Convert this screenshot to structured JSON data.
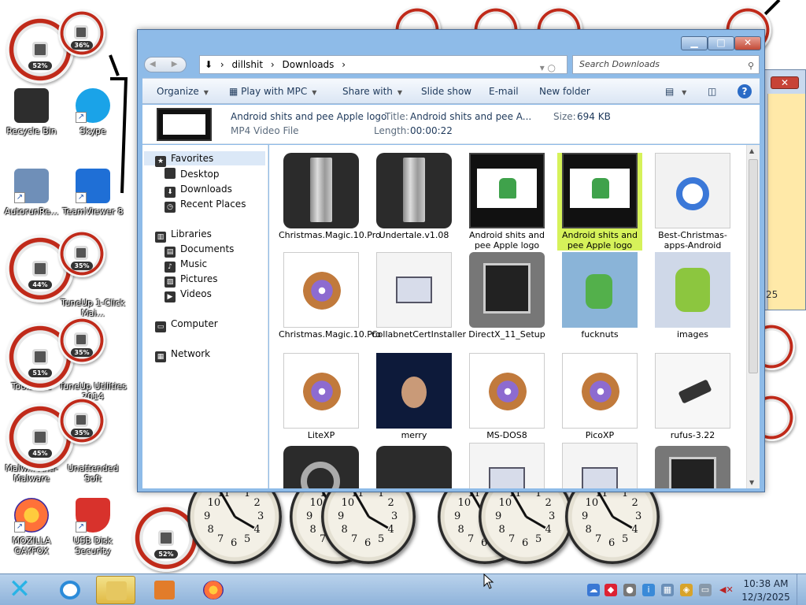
{
  "desktop": {
    "icons": [
      {
        "label": "Recycle Bin"
      },
      {
        "label": "Skype"
      },
      {
        "label": "AutorunRe..."
      },
      {
        "label": "TeamViewer 8"
      },
      {
        "label": "TuneUp 1-Click Mai..."
      },
      {
        "label": "TuneUp Utilities 2014"
      },
      {
        "label": "Tools Lite"
      },
      {
        "label": "Unattended Soft"
      },
      {
        "label": "Malw... Anti-Malware"
      },
      {
        "label": "MOZILLA GAYFOX"
      },
      {
        "label": "USB Disk Security"
      }
    ],
    "gauges": [
      "52%",
      "36%",
      "44%",
      "35%",
      "51%",
      "35%",
      "45%",
      "35%",
      "52%"
    ],
    "clock_numerals": [
      "12",
      "1",
      "2",
      "3",
      "4",
      "5",
      "6",
      "7",
      "8",
      "9",
      "10",
      "11"
    ],
    "bg_window_number": "25"
  },
  "explorer": {
    "address": {
      "segments": [
        "dillshit",
        "Downloads"
      ],
      "search_placeholder": "Search Downloads"
    },
    "toolbar": {
      "organize": "Organize",
      "play": "Play with MPC",
      "share": "Share with",
      "slideshow": "Slide show",
      "email": "E-mail",
      "new_folder": "New folder"
    },
    "details": {
      "name": "Android shits and pee Apple logo",
      "type": "MP4 Video File",
      "title_label": "Title:",
      "title_value": "Android shits and pee A...",
      "length_label": "Length:",
      "length_value": "00:00:22",
      "size_label": "Size:",
      "size_value": "694 KB"
    },
    "nav": {
      "favorites": "Favorites",
      "desktop": "Desktop",
      "downloads": "Downloads",
      "recent": "Recent Places",
      "libraries": "Libraries",
      "documents": "Documents",
      "music": "Music",
      "pictures": "Pictures",
      "videos": "Videos",
      "computer": "Computer",
      "network": "Network"
    },
    "files": [
      {
        "name": "Christmas.Magic.10.Pro"
      },
      {
        "name": "Undertale.v1.08"
      },
      {
        "name": "Android shits and pee Apple logo"
      },
      {
        "name": "Android shits and pee Apple logo"
      },
      {
        "name": "Best-Christmas-apps-Android"
      },
      {
        "name": "Christmas.Magic.10.Pro"
      },
      {
        "name": "CollabnetCertInstaller"
      },
      {
        "name": "DirectX_11_Setup"
      },
      {
        "name": "fucknuts"
      },
      {
        "name": "images"
      },
      {
        "name": "LiteXP"
      },
      {
        "name": "merry"
      },
      {
        "name": "MS-DOS8"
      },
      {
        "name": "PicoXP"
      },
      {
        "name": "rufus-3.22"
      }
    ]
  },
  "taskbar": {
    "time": "10:38 AM",
    "date": "12/3/2025"
  }
}
